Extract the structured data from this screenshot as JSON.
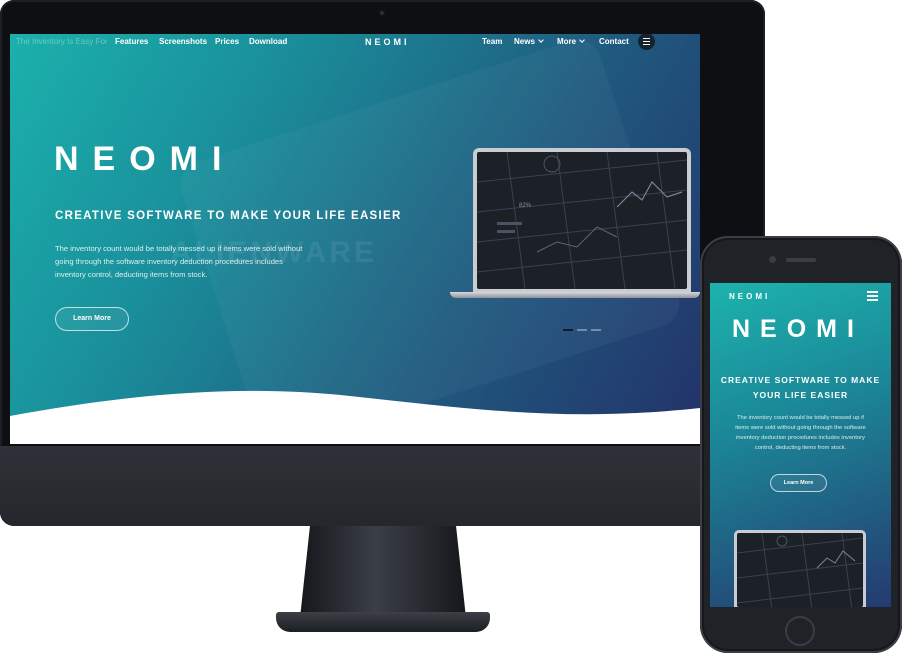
{
  "desktop": {
    "nav": {
      "faded_text": "The Inventory Is Easy For",
      "links": [
        "Features",
        "Screenshots",
        "Prices",
        "Download"
      ],
      "logo": "NEOMI",
      "right_links": [
        "Team",
        "News",
        "More",
        "Contact"
      ]
    },
    "hero": {
      "logo": "NEOMI",
      "title": "CREATIVE SOFTWARE TO MAKE YOUR LIFE EASIER",
      "text": "The inventory count would be totally messed up if items were sold without going through the software inventory deduction procedures includes inventory control, deducting items from stock.",
      "button": "Learn More",
      "background_text": "ALIENWARE"
    }
  },
  "mobile": {
    "small_logo": "NEOMI",
    "logo": "NEOMI",
    "title": "CREATIVE SOFTWARE TO MAKE YOUR LIFE EASIER",
    "text": "The inventory count would be totally messed up if items were sold without going through the software inventory deduction procedures includes inventory control, deducting items from stock.",
    "button": "Learn More"
  },
  "colors": {
    "gradient_start": "#1bb1ac",
    "gradient_end": "#23326a",
    "frame": "#0d0f12"
  }
}
